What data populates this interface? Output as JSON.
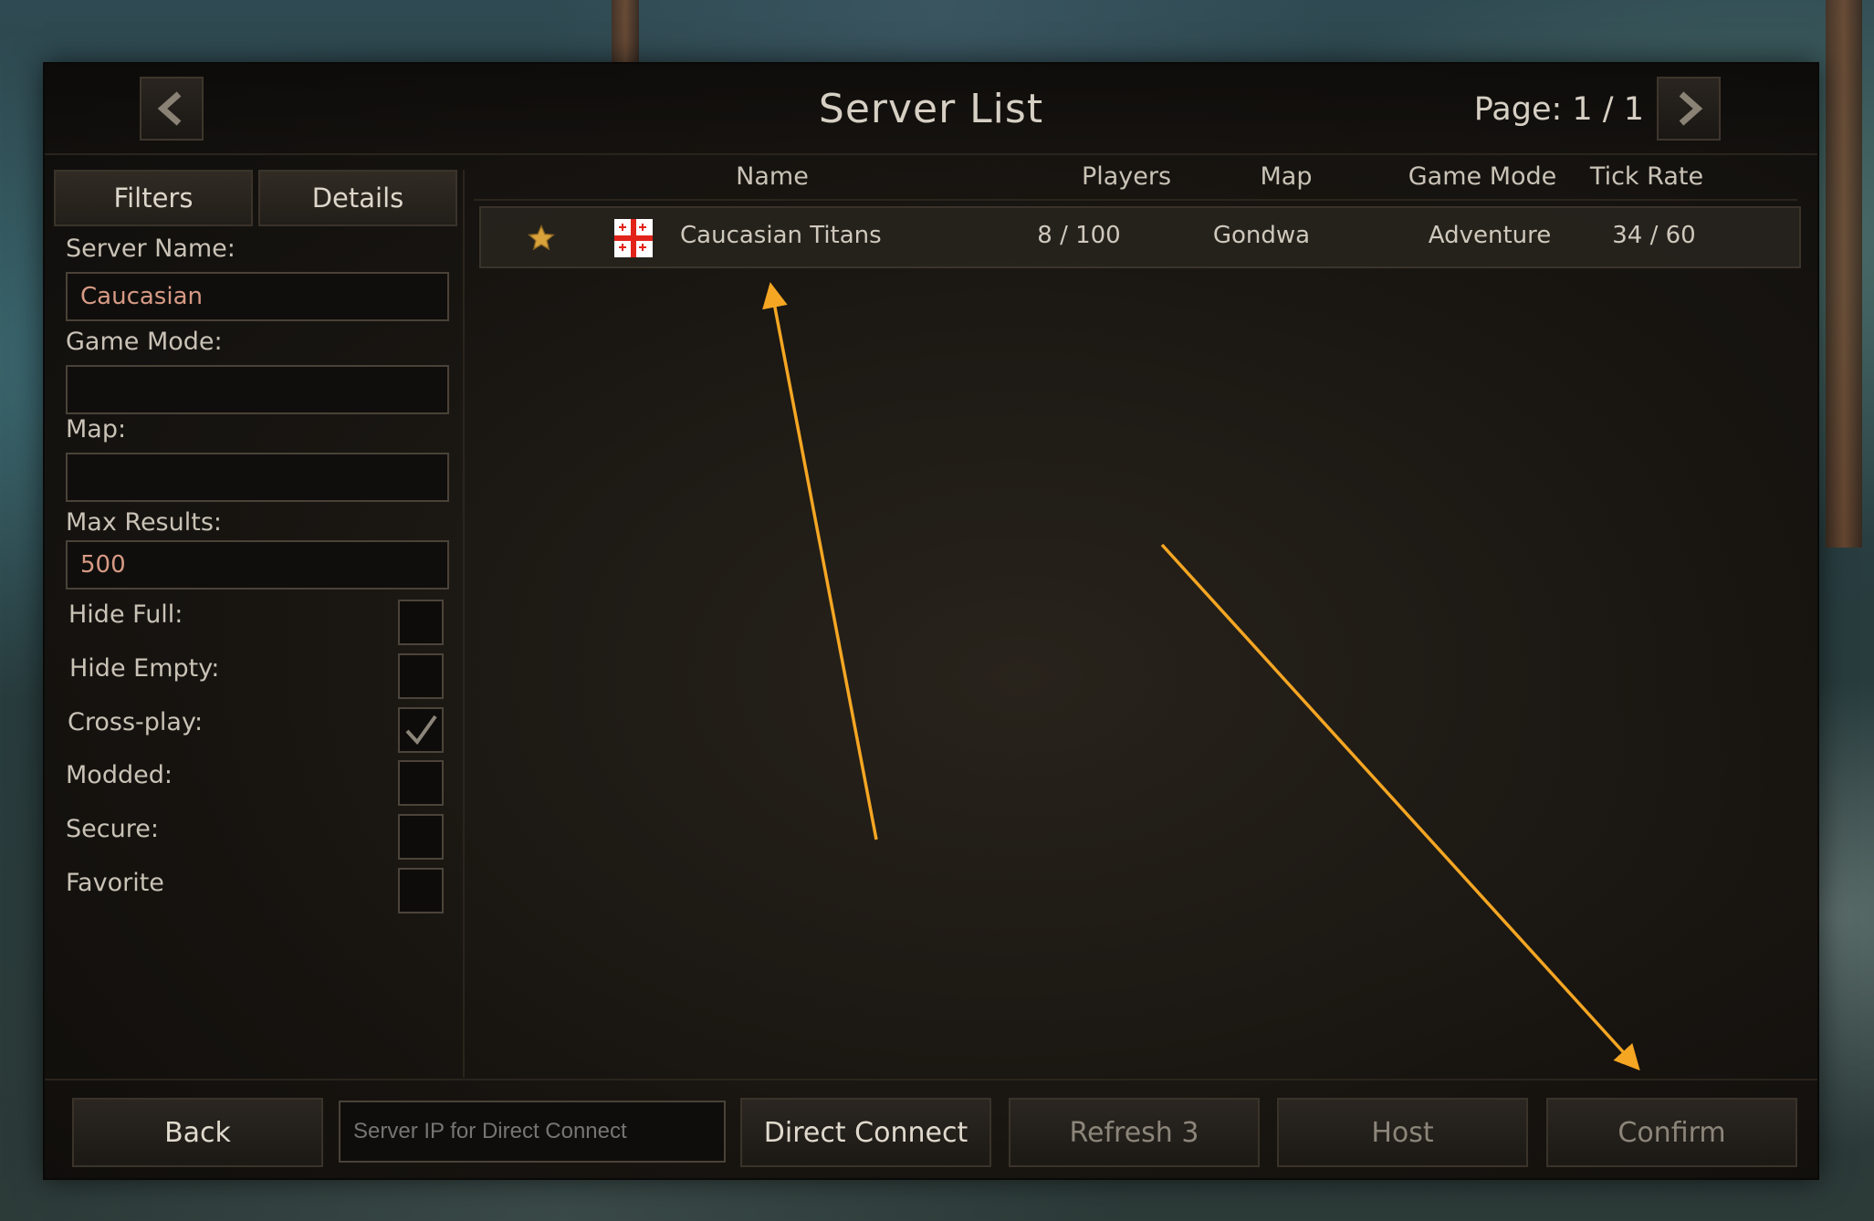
{
  "header": {
    "title": "Server List",
    "page_label": "Page: 1 / 1",
    "prev_icon": "chevron-left-icon",
    "next_icon": "chevron-right-icon"
  },
  "sidebar": {
    "tabs": [
      {
        "label": "Filters"
      },
      {
        "label": "Details"
      }
    ],
    "fields": [
      {
        "label": "Server Name:",
        "value": "Caucasian"
      },
      {
        "label": "Game Mode:",
        "value": ""
      },
      {
        "label": "Map:",
        "value": ""
      },
      {
        "label": "Max Results:",
        "value": "500"
      }
    ],
    "checks": [
      {
        "label": "Hide Full:",
        "checked": false
      },
      {
        "label": "Hide Empty:",
        "checked": false
      },
      {
        "label": "Cross-play:",
        "checked": true
      },
      {
        "label": "Modded:",
        "checked": false
      },
      {
        "label": "Secure:",
        "checked": false
      },
      {
        "label": "Favorite",
        "checked": false
      }
    ]
  },
  "table": {
    "columns": [
      "Name",
      "Players",
      "Map",
      "Game Mode",
      "Tick Rate"
    ],
    "rows": [
      {
        "favorite_icon": "star-icon",
        "flag_icon": "georgia-flag-icon",
        "name": "Caucasian Titans",
        "players": "8 / 100",
        "map": "Gondwa",
        "game_mode": "Adventure",
        "tick_rate": "34 / 60"
      }
    ]
  },
  "footer": {
    "back_label": "Back",
    "ip_placeholder": "Server IP for Direct Connect",
    "direct_connect_label": "Direct Connect",
    "refresh_label": "Refresh 3",
    "host_label": "Host",
    "confirm_label": "Confirm"
  },
  "colors": {
    "annotation_arrow": "#f5a623",
    "input_text": "#d79a85",
    "star": "#d9a23a",
    "flag_red": "#e2231a"
  }
}
